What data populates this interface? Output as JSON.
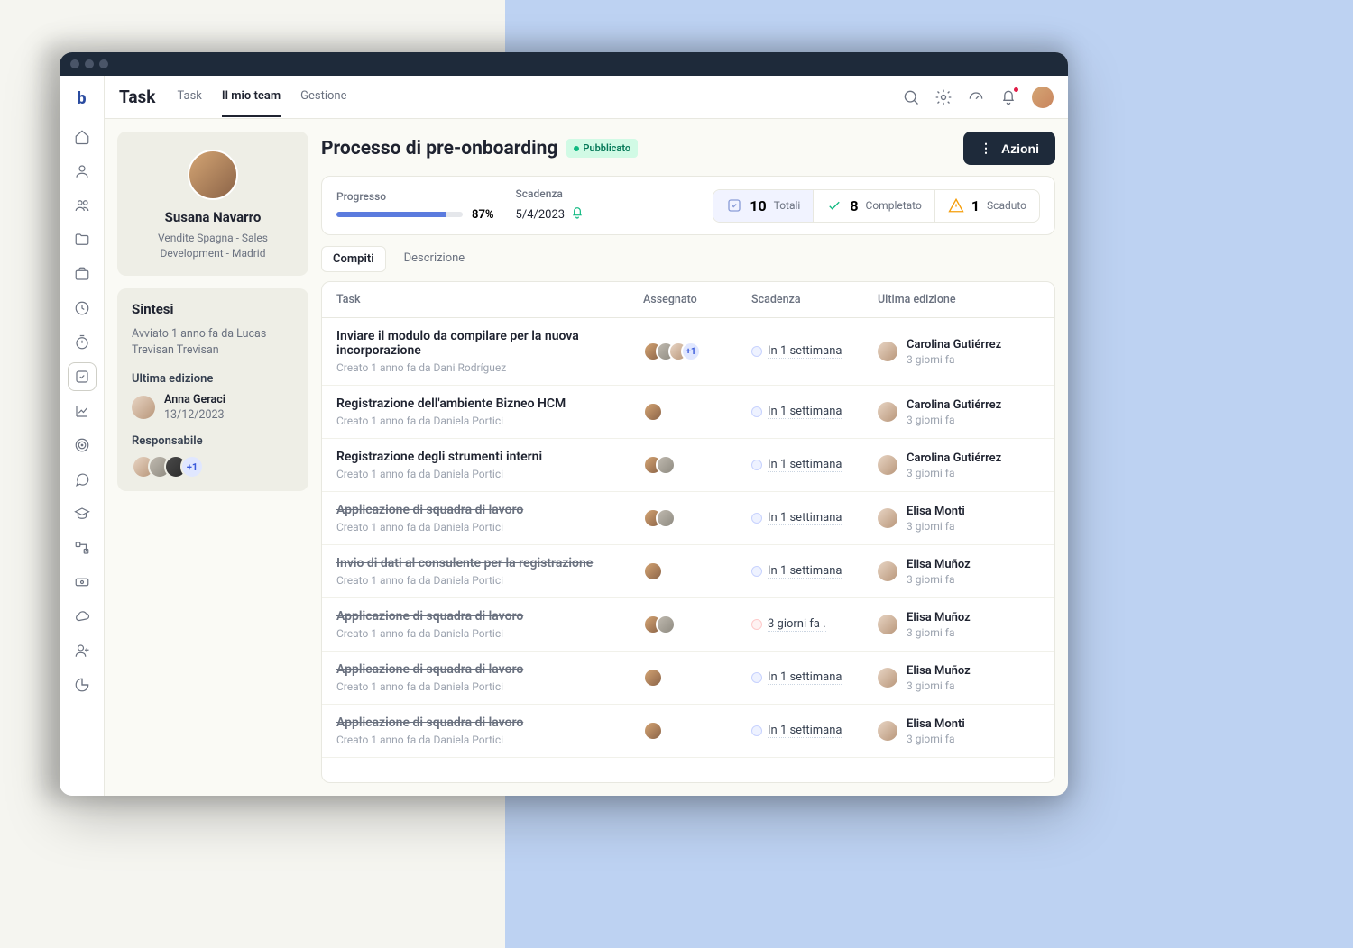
{
  "app_title": "Task",
  "top_tabs": [
    {
      "label": "Task",
      "active": false
    },
    {
      "label": "Il mio team",
      "active": true
    },
    {
      "label": "Gestione",
      "active": false
    }
  ],
  "profile": {
    "name": "Susana Navarro",
    "subtitle": "Vendite Spagna - Sales Development - Madrid"
  },
  "summary": {
    "heading": "Sintesi",
    "started": "Avviato 1 anno fa da Lucas Trevisan Trevisan",
    "last_edit_label": "Ultima edizione",
    "editor_name": "Anna Geraci",
    "editor_date": "13/12/2023",
    "responsible_label": "Responsabile",
    "responsible_extra": "+1"
  },
  "page": {
    "title": "Processo di pre-onboarding",
    "status_badge": "Pubblicato",
    "actions_btn": "Azioni"
  },
  "stats": {
    "progress_label": "Progresso",
    "progress_pct": "87%",
    "deadline_label": "Scadenza",
    "deadline_date": "5/4/2023",
    "totals": {
      "num": "10",
      "label": "Totali"
    },
    "completed": {
      "num": "8",
      "label": "Completato"
    },
    "overdue": {
      "num": "1",
      "label": "Scaduto"
    }
  },
  "inner_tabs": [
    {
      "label": "Compiti",
      "active": true
    },
    {
      "label": "Descrizione",
      "active": false
    }
  ],
  "columns": {
    "task": "Task",
    "assigned": "Assegnato",
    "deadline": "Scadenza",
    "last_edit": "Ultima edizione"
  },
  "tasks": [
    {
      "title": "Inviare il modulo da compilare per la nuova incorporazione",
      "meta": "Creato 1 anno fa da Dani Rodríguez",
      "strike": false,
      "assignees": 3,
      "extra": "+1",
      "deadline": "In 1 settimana",
      "overdue": false,
      "editor": "Carolina Gutiérrez",
      "ago": "3 giorni fa"
    },
    {
      "title": "Registrazione dell'ambiente Bizneo HCM",
      "meta": "Creato 1 anno fa da Daniela Portici",
      "strike": false,
      "assignees": 1,
      "extra": "",
      "deadline": "In 1 settimana",
      "overdue": false,
      "editor": "Carolina Gutiérrez",
      "ago": "3 giorni fa"
    },
    {
      "title": "Registrazione degli strumenti interni",
      "meta": "Creato 1 anno fa da Daniela Portici",
      "strike": false,
      "assignees": 2,
      "extra": "",
      "deadline": "In 1 settimana",
      "overdue": false,
      "editor": "Carolina Gutiérrez",
      "ago": "3 giorni fa"
    },
    {
      "title": "Applicazione di squadra di lavoro",
      "meta": "Creato 1 anno fa da Daniela Portici",
      "strike": true,
      "assignees": 2,
      "extra": "",
      "deadline": "In 1 settimana",
      "overdue": false,
      "editor": "Elisa Monti",
      "ago": "3 giorni fa"
    },
    {
      "title": "Invio di dati al consulente per la registrazione",
      "meta": "Creato 1 anno fa da Daniela Portici",
      "strike": true,
      "assignees": 1,
      "extra": "",
      "deadline": "In 1 settimana",
      "overdue": false,
      "editor": "Elisa Muñoz",
      "ago": "3 giorni fa"
    },
    {
      "title": "Applicazione di squadra di lavoro",
      "meta": "Creato 1 anno fa da Daniela Portici",
      "strike": true,
      "assignees": 2,
      "extra": "",
      "deadline": "3 giorni fa .",
      "overdue": true,
      "editor": "Elisa Muñoz",
      "ago": "3 giorni fa"
    },
    {
      "title": "Applicazione di squadra di lavoro",
      "meta": "Creato 1 anno fa da Daniela Portici",
      "strike": true,
      "assignees": 1,
      "extra": "",
      "deadline": "In 1 settimana",
      "overdue": false,
      "editor": "Elisa Muñoz",
      "ago": "3 giorni fa"
    },
    {
      "title": "Applicazione di squadra di lavoro",
      "meta": "Creato 1 anno fa da Daniela Portici",
      "strike": true,
      "assignees": 1,
      "extra": "",
      "deadline": "In 1 settimana",
      "overdue": false,
      "editor": "Elisa Monti",
      "ago": "3 giorni fa"
    }
  ]
}
